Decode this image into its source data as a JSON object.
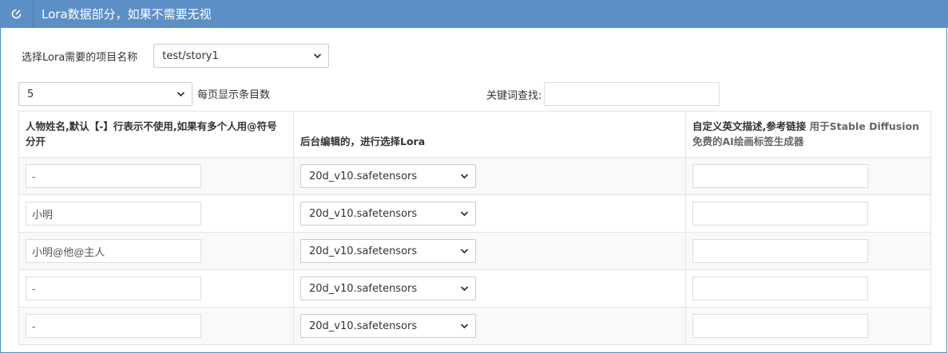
{
  "panel": {
    "icon": "edit-icon",
    "title": "Lora数据部分，如果不需要无视"
  },
  "project_select": {
    "label": "选择Lora需要的项目名称",
    "selected": "test/story1"
  },
  "toolbar": {
    "page_size": "5",
    "page_size_label": "每页显示条目数",
    "search_label": "关键词查找:",
    "search_value": ""
  },
  "table": {
    "headers": {
      "col1": "人物姓名,默认【-】行表示不使用,如果有多个人用@符号分开",
      "col2": "后台编辑的，进行选择Lora",
      "col3": "自定义英文描述,参考链接",
      "col3_link": "用于Stable Diffusion免费的AI绘画标签生成器"
    },
    "rows": [
      {
        "name": "-",
        "lora": "20d_v10.safetensors",
        "desc": ""
      },
      {
        "name": "小明",
        "lora": "20d_v10.safetensors",
        "desc": ""
      },
      {
        "name": "小明@他@主人",
        "lora": "20d_v10.safetensors",
        "desc": ""
      },
      {
        "name": "-",
        "lora": "20d_v10.safetensors",
        "desc": ""
      },
      {
        "name": "-",
        "lora": "20d_v10.safetensors",
        "desc": ""
      }
    ]
  },
  "colors": {
    "header_bg": "#5b8fc5",
    "row_alt": "#f9f9f9"
  }
}
